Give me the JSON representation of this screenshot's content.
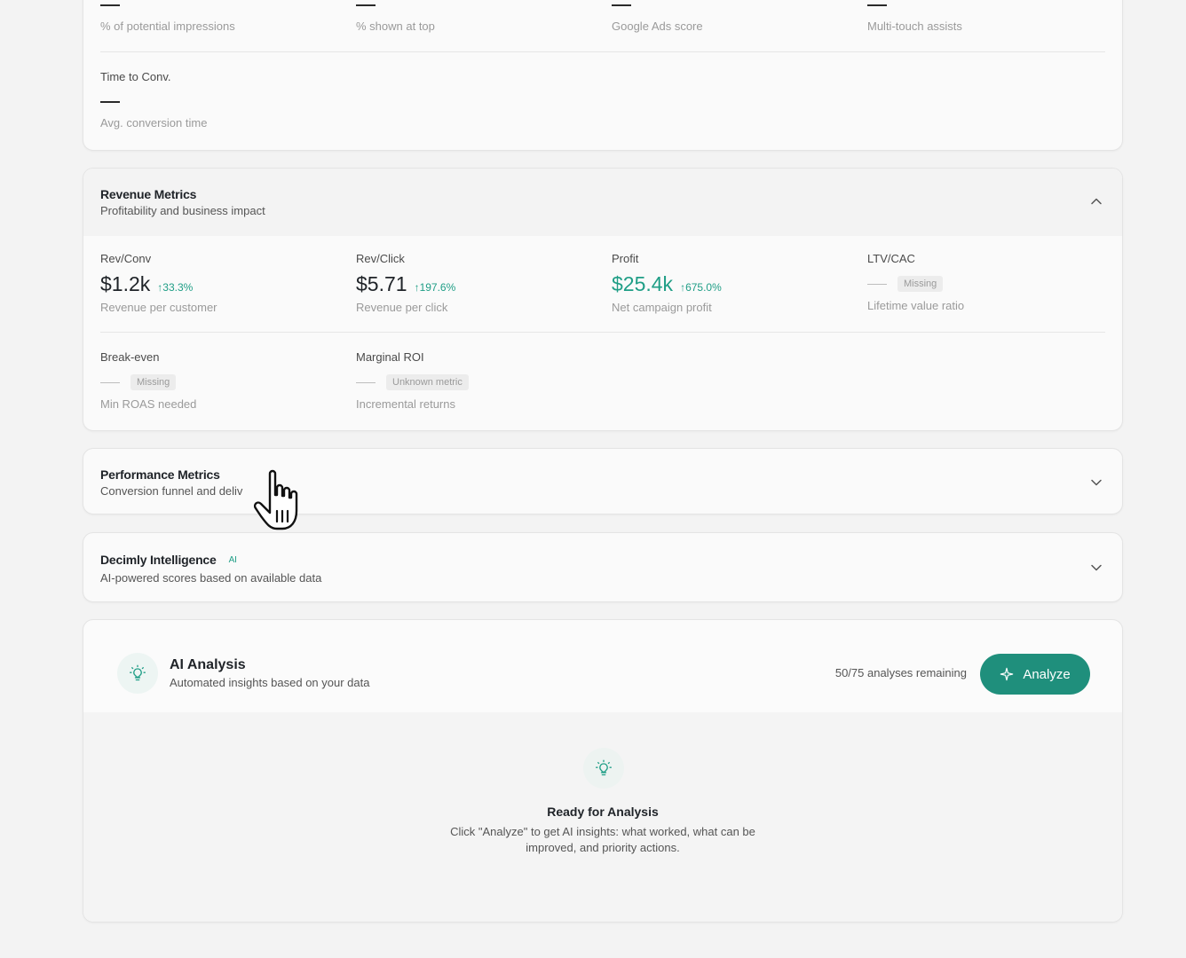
{
  "top_card": {
    "row1": [
      {
        "sub": "% of potential impressions"
      },
      {
        "sub": "% shown at top"
      },
      {
        "sub": "Google Ads score"
      },
      {
        "sub": "Multi-touch assists"
      }
    ],
    "time_to_conv": {
      "label": "Time to Conv.",
      "sub": "Avg. conversion time"
    }
  },
  "revenue": {
    "title": "Revenue Metrics",
    "subtitle": "Profitability and business impact",
    "metrics": [
      {
        "label": "Rev/Conv",
        "value": "$1.2k",
        "change": "↑33.3%",
        "sub": "Revenue per customer"
      },
      {
        "label": "Rev/Click",
        "value": "$5.71",
        "change": "↑197.6%",
        "sub": "Revenue per click"
      },
      {
        "label": "Profit",
        "value": "$25.4k",
        "change": "↑675.0%",
        "sub": "Net campaign profit"
      },
      {
        "label": "LTV/CAC",
        "status": "Missing",
        "sub": "Lifetime value ratio"
      },
      {
        "label": "Break-even",
        "status": "Missing",
        "sub": "Min ROAS needed"
      },
      {
        "label": "Marginal ROI",
        "status": "Unknown metric",
        "sub": "Incremental returns"
      }
    ]
  },
  "performance": {
    "title": "Performance Metrics",
    "subtitle": "Conversion funnel and deliv"
  },
  "intelligence": {
    "title": "Decimly Intelligence",
    "badge": "AI",
    "subtitle": "AI-powered scores based on available data"
  },
  "ai_analysis": {
    "title": "AI Analysis",
    "subtitle": "Automated insights based on your data",
    "remaining": "50/75 analyses remaining",
    "button": "Analyze",
    "empty_title": "Ready for Analysis",
    "empty_line1": "Click \"Analyze\" to get AI insights: what worked, what can be",
    "empty_line2": "improved, and priority actions."
  },
  "colors": {
    "accent": "#1f9e86",
    "button": "#1f8f7c"
  },
  "icons": [
    "chevron-up-icon",
    "chevron-down-icon",
    "lightbulb-icon",
    "sparkle-icon",
    "hand-cursor-icon"
  ]
}
